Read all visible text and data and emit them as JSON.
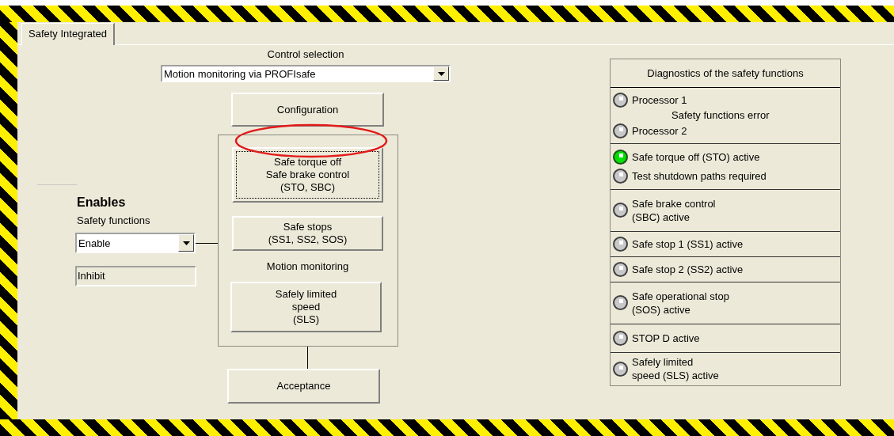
{
  "tabs": [
    {
      "label": "Safety Integrated",
      "selected": true
    }
  ],
  "enables": {
    "title": "Enables",
    "subtitle": "Safety functions",
    "select_value": "Enable",
    "status_value": "Inhibit"
  },
  "control_selection": {
    "label": "Control selection",
    "value": "Motion monitoring via PROFIsafe"
  },
  "configuration_button": "Configuration",
  "frame_items": [
    {
      "kind": "button",
      "label": "Safe torque off\nSafe brake control\n(STO, SBC)",
      "focused": true
    },
    {
      "kind": "button",
      "label": "Safe stops\n(SS1, SS2, SOS)",
      "focused": false
    },
    {
      "kind": "label",
      "label": "Motion monitoring"
    },
    {
      "kind": "button",
      "label": "Safely limited\nspeed\n(SLS)",
      "focused": false
    }
  ],
  "acceptance_button": "Acceptance",
  "diagnostics": {
    "title": "Diagnostics of the safety functions",
    "groups": [
      {
        "caption": "Safety functions error",
        "indicators": [
          {
            "label": "Processor 1",
            "on": false
          },
          {
            "label": "Processor 2",
            "on": false
          }
        ]
      },
      {
        "indicators": [
          {
            "label": "Safe torque off (STO) active",
            "on": true
          },
          {
            "label": "Test shutdown paths required",
            "on": false
          }
        ]
      },
      {
        "indicators": [
          {
            "label": "Safe brake control\n(SBC) active",
            "on": false
          }
        ]
      },
      {
        "indicators": [
          {
            "label": "Safe stop 1 (SS1) active",
            "on": false
          }
        ]
      },
      {
        "indicators": [
          {
            "label": "Safe stop 2 (SS2) active",
            "on": false
          }
        ]
      },
      {
        "indicators": [
          {
            "label": "Safe operational stop\n(SOS) active",
            "on": false
          }
        ]
      },
      {
        "indicators": [
          {
            "label": "STOP D active",
            "on": false
          }
        ]
      },
      {
        "indicators": [
          {
            "label": "Safely limited\nspeed (SLS) active",
            "on": false
          }
        ]
      }
    ]
  }
}
